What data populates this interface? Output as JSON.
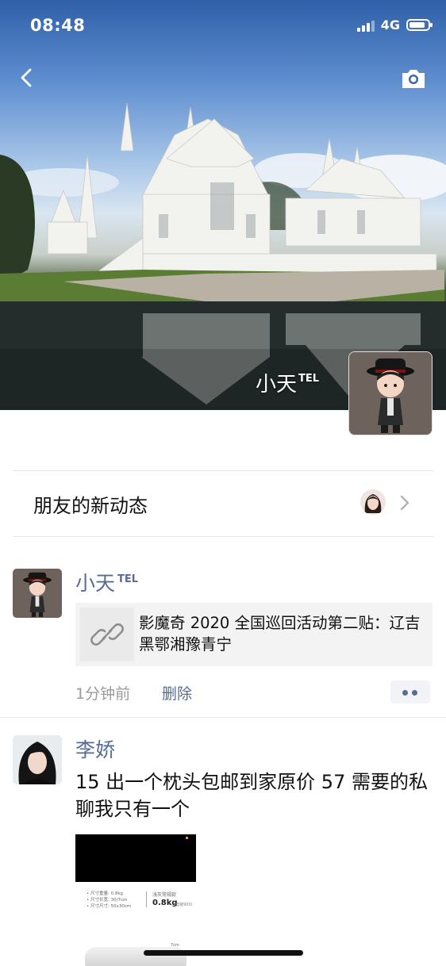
{
  "status_bar": {
    "time": "08:48",
    "network": "4G"
  },
  "header": {
    "back_icon": "chevron-left-icon",
    "camera_icon": "camera-icon"
  },
  "cover": {
    "name": "小天",
    "name_suffix": "TEL"
  },
  "friend_updates": {
    "label": "朋友的新动态",
    "chevron_icon": "chevron-right-icon"
  },
  "posts": [
    {
      "author": "小天",
      "author_suffix": "TEL",
      "link_title": "影魔奇 2020 全国巡回活动第二贴：辽吉黑鄂湘豫青宁",
      "link_icon": "link-icon",
      "time": "1分钟前",
      "delete_label": "删除",
      "more_icon": "more-dots-icon"
    },
    {
      "author": "李娇",
      "text": "15 出一个枕头包邮到家原价 57 需要的私聊我只有一个",
      "image_spec_left": [
        "• 尺寸重量: 0.8kg",
        "• 尺寸长宽: 30/7cm",
        "• 尺寸尺寸: 50x30cm"
      ],
      "image_spec_right_title": "浅灰常规款",
      "image_spec_right_value": "0.8kg",
      "image_spec_right_note": "(套装900)",
      "image_bottom_label": "7cm"
    }
  ],
  "colors": {
    "link_blue": "#576b95",
    "secondary_text": "#9a9a9a",
    "card_bg": "#f3f3f3"
  }
}
